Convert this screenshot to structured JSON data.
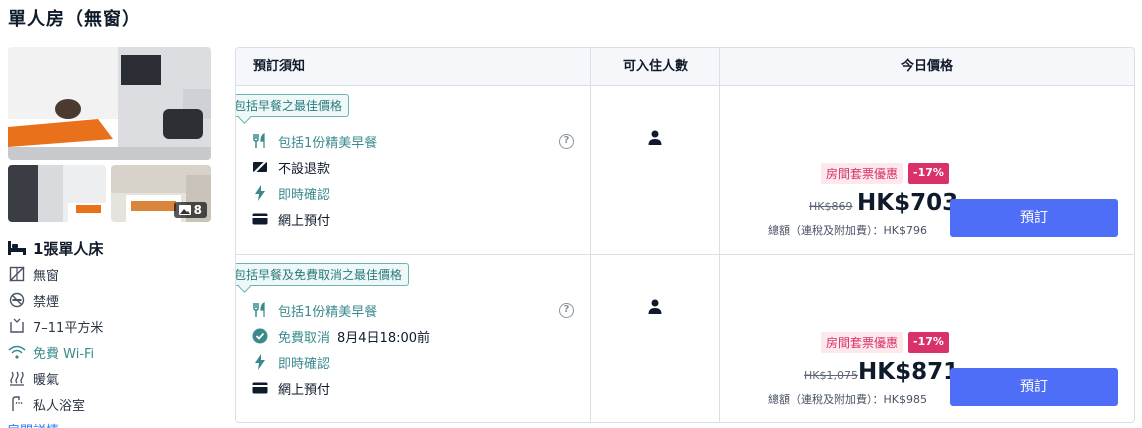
{
  "room": {
    "title": "單人房（無窗）",
    "photo_count": "8",
    "features": [
      {
        "icon": "bed-icon",
        "label": "1張單人床"
      },
      {
        "icon": "no-window-icon",
        "label": "無窗"
      },
      {
        "icon": "no-smoking-icon",
        "label": "禁煙"
      },
      {
        "icon": "room-size-icon",
        "label": "7–11平方米"
      },
      {
        "icon": "wifi-icon",
        "label": "免費 Wi-Fi"
      },
      {
        "icon": "heating-icon",
        "label": "暖氣"
      },
      {
        "icon": "private-bathroom-icon",
        "label": "私人浴室"
      }
    ],
    "more_link": "房間詳情"
  },
  "table": {
    "headers": {
      "policy": "預訂須知",
      "occupancy": "可入住人數",
      "price": "今日價格"
    },
    "rows": [
      {
        "tag": "包括早餐之最佳價格",
        "items": [
          {
            "icon": "cutlery-icon",
            "label": "包括1份精美早餐",
            "color": "teal"
          },
          {
            "icon": "no-refund-icon",
            "label": "不設退款",
            "color": "dark"
          },
          {
            "icon": "lightning-icon",
            "label": "即時確認",
            "color": "teal"
          },
          {
            "icon": "card-icon",
            "label": "網上預付",
            "color": "dark"
          }
        ],
        "help": "?",
        "promo_label": "房間套票優惠",
        "promo_pct": "-17%",
        "old_price": "HK$869",
        "price": "HK$703",
        "total": "總額（連稅及附加費）：HK$796",
        "book_label": "預訂"
      },
      {
        "tag": "包括早餐及免費取消之最佳價格",
        "items": [
          {
            "icon": "cutlery-icon",
            "label": "包括1份精美早餐",
            "color": "teal"
          },
          {
            "icon": "check-circle-icon",
            "label": "免費取消",
            "extra": "8月4日18:00前",
            "color": "teal"
          },
          {
            "icon": "lightning-icon",
            "label": "即時確認",
            "color": "teal"
          },
          {
            "icon": "card-icon",
            "label": "網上預付",
            "color": "dark"
          }
        ],
        "help": "?",
        "promo_label": "房間套票優惠",
        "promo_pct": "-17%",
        "old_price": "HK$1,075",
        "price": "HK$871",
        "total": "總額（連稅及附加費）：HK$985",
        "book_label": "預訂"
      }
    ]
  },
  "colors": {
    "accent": "#4f6ef7",
    "teal": "#3a8a8c",
    "promo": "#d9326a"
  }
}
